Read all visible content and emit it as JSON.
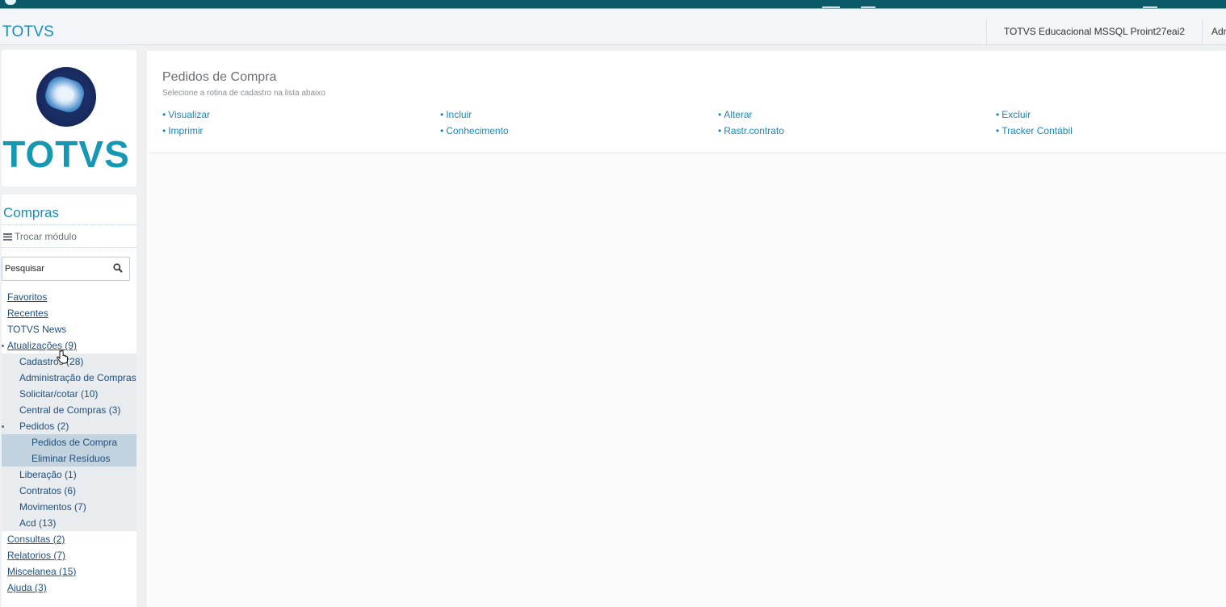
{
  "header": {
    "brand": "TOTVS",
    "environment": "TOTVS Educacional MSSQL Proint27eai2",
    "user": "Adm"
  },
  "logo": {
    "wordmark": "TOTVS"
  },
  "sidebar": {
    "title": "Compras",
    "switch_label": "Trocar módulo",
    "search_placeholder": "Pesquisar",
    "items": [
      {
        "label": "Favoritos",
        "level": 1
      },
      {
        "label": "Recentes",
        "level": 1
      },
      {
        "label": "TOTVS News",
        "level": 1
      },
      {
        "label": "Atualizações (9)",
        "level": 1,
        "expanded": true
      },
      {
        "label": "Cadastros (28)",
        "level": 2
      },
      {
        "label": "Administração de Compras",
        "level": 2
      },
      {
        "label": "Solicitar/cotar (10)",
        "level": 2
      },
      {
        "label": "Central de Compras (3)",
        "level": 2
      },
      {
        "label": "Pedidos (2)",
        "level": 2,
        "expanded": true
      },
      {
        "label": "Pedidos de Compra",
        "level": 3,
        "selected": true
      },
      {
        "label": "Eliminar Resíduos",
        "level": 3
      },
      {
        "label": "Liberação (1)",
        "level": 2
      },
      {
        "label": "Contratos (6)",
        "level": 2
      },
      {
        "label": "Movimentos (7)",
        "level": 2
      },
      {
        "label": "Acd (13)",
        "level": 2
      },
      {
        "label": "Consultas (2)",
        "level": 1
      },
      {
        "label": "Relatorios (7)",
        "level": 1
      },
      {
        "label": "Miscelanea (15)",
        "level": 1
      },
      {
        "label": "Ajuda (3)",
        "level": 1
      }
    ]
  },
  "main": {
    "title": "Pedidos de Compra",
    "subtitle": "Selecione a rotina de cadastro na lista abaixo",
    "actions": [
      "Visualizar",
      "Incluir",
      "Alterar",
      "Excluir",
      "Imprimir",
      "Conhecimento",
      "Rastr.contrato",
      "Tracker Contábil"
    ]
  },
  "colors": {
    "brand_blue": "#1a8fb6",
    "top_strip": "#0b5a69",
    "link": "#1d86b5",
    "selected_row": "#c2d3df"
  }
}
